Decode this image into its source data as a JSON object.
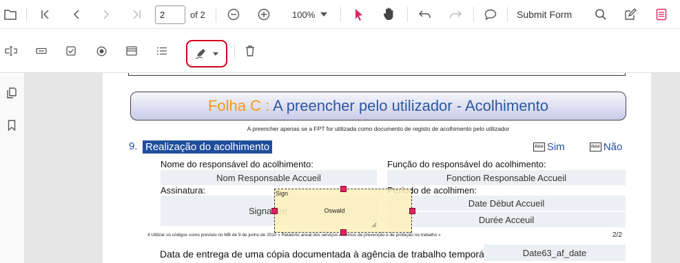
{
  "toolbar": {
    "page_input_value": "2",
    "page_total": "of 2",
    "zoom_value": "100%",
    "submit_form_label": "Submit Form"
  },
  "document": {
    "banner_prefix": "Folha C :",
    "banner_title": " A preencher pelo utilizador - Acolhimento",
    "subtitle": "A preencher apenas se a FPT for utilizada como documento de registo de acolhimento pelo utilizador",
    "section_number": "9.",
    "section_title": "Realização do acolhimento",
    "option_yes_icon": "Réé",
    "option_yes_label": "Sim",
    "option_no_icon": "Réé",
    "option_no_label": "Não",
    "label_responsavel": "Nome do responsável do acolhimento:",
    "field_responsavel": "Nom Responsable Accueil",
    "label_funcao": "Função do responsável do acolhimento:",
    "field_funcao": "Fonction Responsable Accueil",
    "label_assinatura": "Assinatura:",
    "field_signature_text": "Signature",
    "label_periodo": "Período de acolhimen:",
    "field_date_debut": "Date Début Accueil",
    "field_duree": "Durée Acceuil",
    "footnote": "4 Utilizar os códigos como previsto no MB de 9 de junho de 2010 « Relatório anual dos serviços externos de prevenção e de proteção no trabalho »",
    "page_number": "2/2",
    "label_data_entrega": "Data de entrega de uma cópia documentada à agência de trabalho temporário:",
    "field_date63": "Date63_af_date",
    "sign_annotation_label": "Sign",
    "sign_annotation_value": "Oswald"
  },
  "colors": {
    "accent_pink": "#e0245e",
    "section_blue": "#1f4e9c",
    "banner_orange": "#f39c12",
    "banner_blue": "#2c5aa0",
    "highlight_red": "#d0021b"
  }
}
